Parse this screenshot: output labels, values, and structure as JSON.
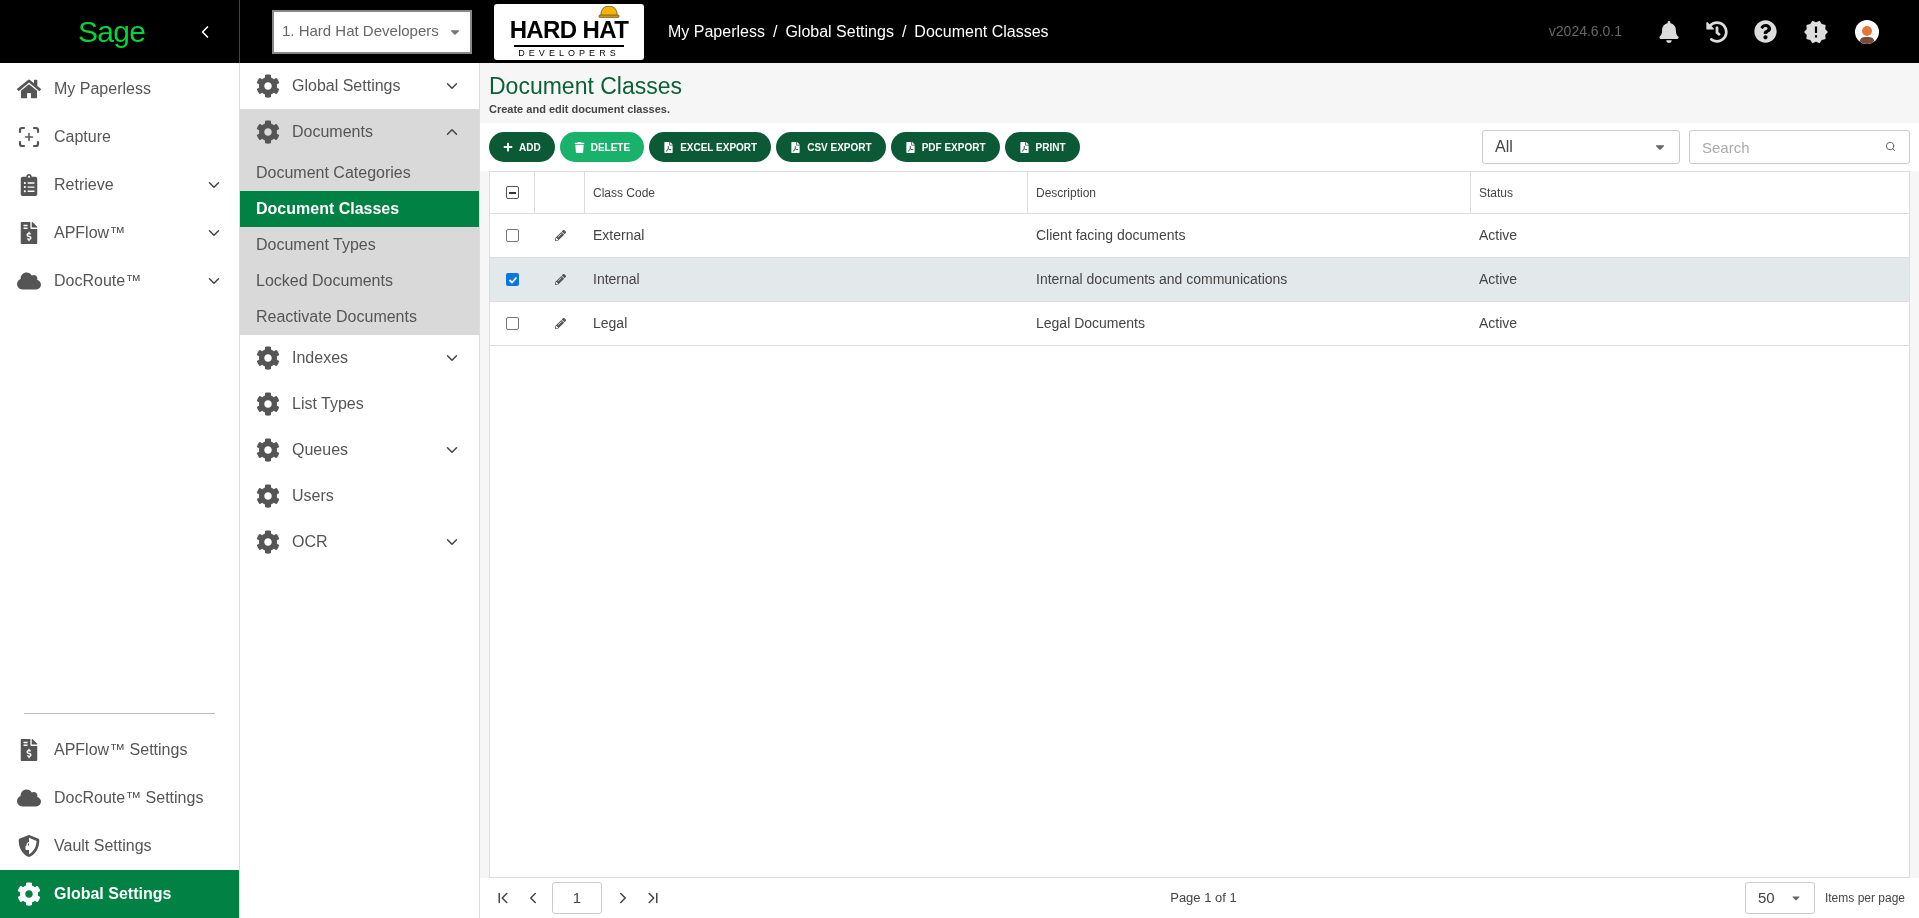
{
  "sidebar": {
    "logo": "Sage",
    "items": [
      {
        "label": "My Paperless",
        "selected": false
      },
      {
        "label": "Capture",
        "selected": false
      },
      {
        "label": "Retrieve",
        "selected": false,
        "expanded": false
      },
      {
        "label": "APFlow™",
        "selected": false,
        "expanded": false
      },
      {
        "label": "DocRoute™",
        "selected": false,
        "expanded": false
      }
    ],
    "bottom_items": [
      {
        "label": "APFlow™ Settings",
        "selected": false
      },
      {
        "label": "DocRoute™ Settings",
        "selected": false
      },
      {
        "label": "Vault Settings",
        "selected": false
      },
      {
        "label": "Global Settings",
        "selected": true
      }
    ]
  },
  "header": {
    "company_select": "1. Hard Hat Developers",
    "logo_text": "HARD HAT",
    "logo_subtext": "DEVELOPERS",
    "breadcrumbs": [
      "My Paperless",
      "Global Settings",
      "Document Classes"
    ],
    "breadcrumb_separator": "/",
    "version": "v2024.6.0.1"
  },
  "settings_nav": [
    {
      "label": "Global Settings",
      "expanded": false
    },
    {
      "label": "Documents",
      "expanded": true,
      "children": [
        {
          "label": "Document Categories",
          "selected": false
        },
        {
          "label": "Document Classes",
          "selected": true
        },
        {
          "label": "Document Types",
          "selected": false
        },
        {
          "label": "Locked Documents",
          "selected": false
        },
        {
          "label": "Reactivate Documents",
          "selected": false
        }
      ]
    },
    {
      "label": "Indexes",
      "expanded": false
    },
    {
      "label": "List Types"
    },
    {
      "label": "Queues",
      "expanded": false
    },
    {
      "label": "Users"
    },
    {
      "label": "OCR",
      "expanded": false
    }
  ],
  "page": {
    "title": "Document Classes",
    "subtitle": "Create and edit document classes."
  },
  "toolbar": [
    {
      "label": "ADD",
      "kind": "add"
    },
    {
      "label": "DELETE",
      "kind": "delete"
    },
    {
      "label": "EXCEL EXPORT",
      "kind": "export"
    },
    {
      "label": "CSV EXPORT",
      "kind": "export"
    },
    {
      "label": "PDF EXPORT",
      "kind": "export"
    },
    {
      "label": "PRINT",
      "kind": "export"
    }
  ],
  "filter": {
    "value": "All"
  },
  "search": {
    "placeholder": "Search"
  },
  "table": {
    "select_all_indeterminate": true,
    "columns": [
      "Class Code",
      "Description",
      "Status"
    ],
    "rows": [
      {
        "cells": [
          "External",
          "Client facing documents",
          "Active"
        ],
        "checked": false
      },
      {
        "cells": [
          "Internal",
          "Internal documents and communications",
          "Active"
        ],
        "checked": true
      },
      {
        "cells": [
          "Legal",
          "Legal Documents",
          "Active"
        ],
        "checked": false
      }
    ]
  },
  "pagination": {
    "page": "1",
    "summary": "Page 1 of 1",
    "page_size": "50",
    "page_size_label": "Items per page"
  }
}
